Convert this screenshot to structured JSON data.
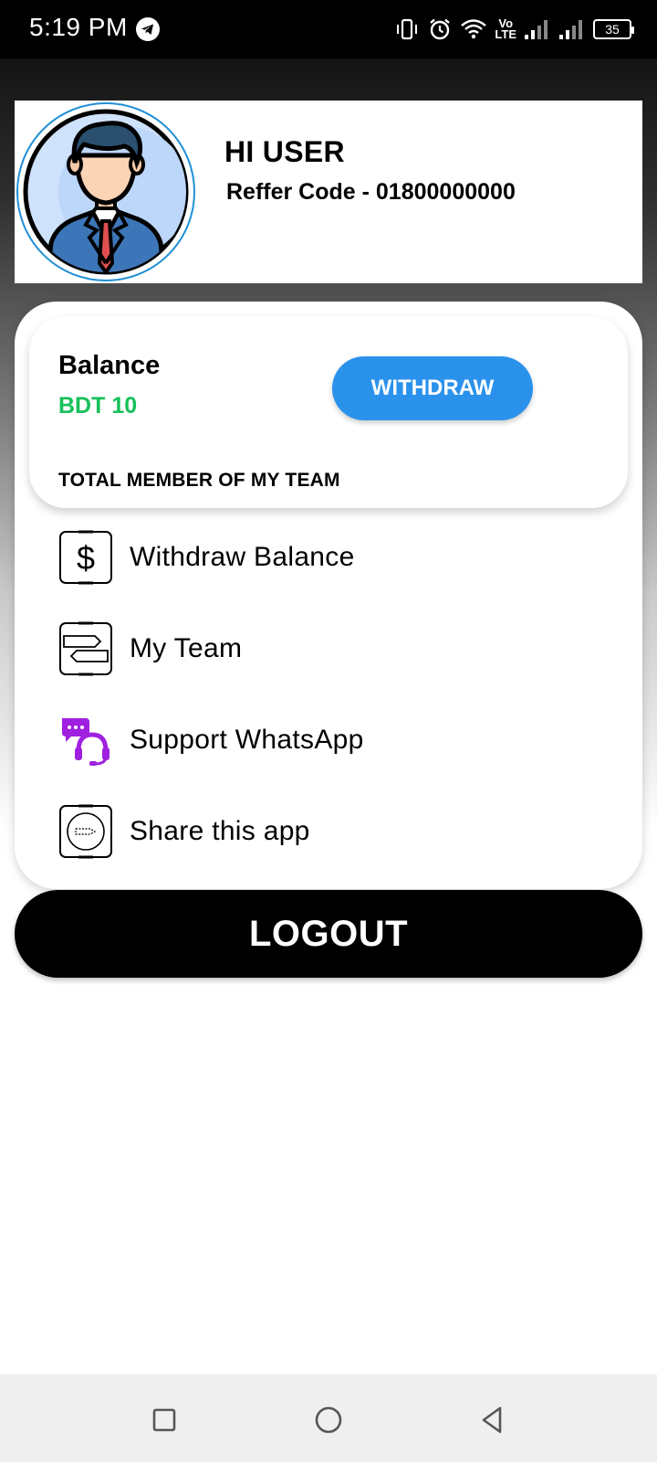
{
  "status_bar": {
    "time": "5:19 PM",
    "lte_top": "Vo",
    "lte_bottom": "LTE",
    "battery": "35"
  },
  "profile": {
    "greeting": "HI USER",
    "refer_text": "Reffer Code - 01800000000"
  },
  "balance": {
    "label": "Balance",
    "value": "BDT 10",
    "withdraw_label": "WITHDRAW",
    "team_label": "TOTAL MEMBER OF MY TEAM"
  },
  "menu": {
    "items": [
      {
        "label": "Withdraw Balance",
        "icon": "dollar-icon"
      },
      {
        "label": "My Team",
        "icon": "signpost-icon"
      },
      {
        "label": "Support WhatsApp",
        "icon": "headset-support-icon"
      },
      {
        "label": "Share this app",
        "icon": "share-icon"
      }
    ]
  },
  "logout_label": "LOGOUT",
  "colors": {
    "accent_blue": "#2b92ec",
    "balance_green": "#17c05a",
    "support_purple": "#a020e0"
  }
}
